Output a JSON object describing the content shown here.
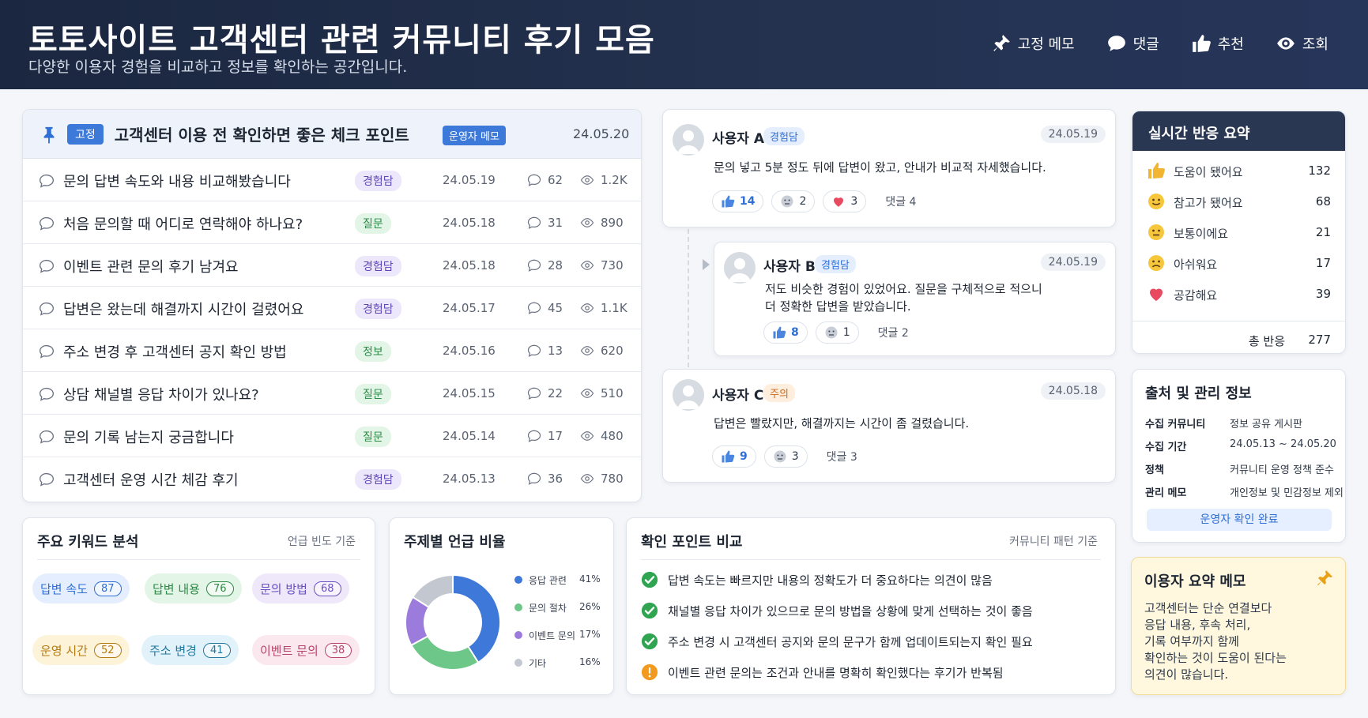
{
  "header": {
    "title": "토토사이트 고객센터 관련 커뮤니티 후기 모음",
    "subtitle": "다양한 이용자 경험을 비교하고 정보를 확인하는 공간입니다.",
    "nav": [
      {
        "label": "고정 메모",
        "icon": "pin-icon"
      },
      {
        "label": "댓글",
        "icon": "comment-icon"
      },
      {
        "label": "추천",
        "icon": "thumbs-up-icon"
      },
      {
        "label": "조회",
        "icon": "eye-icon"
      }
    ]
  },
  "posts": {
    "pinned": {
      "tag": "고정",
      "title": "고객센터 이용 전 확인하면 좋은 체크 포인트",
      "badge": "운영자 메모",
      "date": "24.05.20"
    },
    "rows": [
      {
        "title": "문의 답변 속도와 내용 비교해봤습니다",
        "tag": "경험담",
        "date": "24.05.19",
        "comments": "62",
        "views": "1.2K"
      },
      {
        "title": "처음 문의할 때 어디로 연락해야 하나요?",
        "tag": "질문",
        "date": "24.05.18",
        "comments": "31",
        "views": "890"
      },
      {
        "title": "이벤트 관련 문의 후기 남겨요",
        "tag": "경험담",
        "date": "24.05.18",
        "comments": "28",
        "views": "730"
      },
      {
        "title": "답변은 왔는데 해결까지 시간이 걸렸어요",
        "tag": "경험담",
        "date": "24.05.17",
        "comments": "45",
        "views": "1.1K"
      },
      {
        "title": "주소 변경 후 고객센터 공지 확인 방법",
        "tag": "정보",
        "date": "24.05.16",
        "comments": "13",
        "views": "620"
      },
      {
        "title": "상담 채널별 응답 차이가 있나요?",
        "tag": "질문",
        "date": "24.05.15",
        "comments": "22",
        "views": "510"
      },
      {
        "title": "문의 기록 남는지 궁금합니다",
        "tag": "질문",
        "date": "24.05.14",
        "comments": "17",
        "views": "480"
      },
      {
        "title": "고객센터 운영 시간 체감 후기",
        "tag": "경험담",
        "date": "24.05.13",
        "comments": "36",
        "views": "780"
      }
    ]
  },
  "comments": [
    {
      "user": "사용자 A",
      "tag": "경험담",
      "date": "24.05.19",
      "text": "문의 넣고 5분 정도 뒤에 답변이 왔고, 안내가 비교적 자세했습니다.",
      "likes": "14",
      "neutral": "2",
      "hearts": "3",
      "replies": "댓글 4"
    },
    {
      "user": "사용자 B",
      "tag": "경험담",
      "date": "24.05.19",
      "text1": "저도 비슷한 경험이 있었어요. 질문을 구체적으로 적으니",
      "text2": "더 정확한 답변을 받았습니다.",
      "likes": "8",
      "neutral": "1",
      "replies": "댓글 2"
    },
    {
      "user": "사용자 C",
      "tag": "주의",
      "date": "24.05.18",
      "text": "답변은 빨랐지만, 해결까지는 시간이 좀 걸렸습니다.",
      "likes": "9",
      "neutral": "3",
      "replies": "댓글 3"
    }
  ],
  "summary": {
    "title": "실시간 반응 요약",
    "rows": [
      {
        "label": "도움이 됐어요",
        "value": "132",
        "icon": "thumbs-up-icon"
      },
      {
        "label": "참고가 됐어요",
        "value": "68",
        "icon": "smile-icon"
      },
      {
        "label": "보통이에요",
        "value": "21",
        "icon": "neutral-face-icon"
      },
      {
        "label": "아쉬워요",
        "value": "17",
        "icon": "sad-face-icon"
      },
      {
        "label": "공감해요",
        "value": "39",
        "icon": "heart-icon"
      }
    ],
    "total_label": "총 반응",
    "total_value": "277"
  },
  "source": {
    "title": "출처 및 관리 정보",
    "rows": [
      {
        "key": "수집 커뮤니티",
        "value": "정보 공유 게시판"
      },
      {
        "key": "수집 기간",
        "value": "24.05.13 ~ 24.05.20"
      },
      {
        "key": "정책",
        "value": "커뮤니티 운영 정책 준수"
      },
      {
        "key": "관리 메모",
        "value": "개인정보 및 민감정보 제외"
      }
    ],
    "button": "운영자 확인 완료"
  },
  "memo": {
    "title": "이용자 요약 메모",
    "text": "고객센터는 단순 연결보다\n응답 내용, 후속 처리,\n기록 여부까지 함께\n확인하는 것이 도움이 된다는\n의견이 많습니다."
  },
  "keywords": {
    "title": "주요 키워드 분석",
    "subtitle": "언급 빈도 기준",
    "items": [
      {
        "label": "답변 속도",
        "count": "87",
        "color": "blue"
      },
      {
        "label": "답변 내용",
        "count": "76",
        "color": "green"
      },
      {
        "label": "문의 방법",
        "count": "68",
        "color": "purple"
      },
      {
        "label": "운영 시간",
        "count": "52",
        "color": "yellow"
      },
      {
        "label": "주소 변경",
        "count": "41",
        "color": "cyan"
      },
      {
        "label": "이벤트 문의",
        "count": "38",
        "color": "pink"
      }
    ]
  },
  "ratio": {
    "title": "주제별 언급 비율"
  },
  "chart_data": {
    "type": "pie",
    "categories": [
      "응답 관련",
      "문의 절차",
      "이벤트 문의",
      "기타"
    ],
    "values": [
      41,
      26,
      17,
      16
    ],
    "labels": [
      "41%",
      "26%",
      "17%",
      "16%"
    ],
    "colors": [
      "#3e78d8",
      "#6cc788",
      "#9b7bdc",
      "#c2c7d0"
    ],
    "donut": true
  },
  "compare": {
    "title": "확인 포인트 비교",
    "subtitle": "커뮤니티 패턴 기준",
    "items": [
      {
        "text": "답변 속도는 빠르지만 내용의 정확도가 더 중요하다는 의견이 많음",
        "status": "check"
      },
      {
        "text": "채널별 응답 차이가 있으므로 문의 방법을 상황에 맞게 선택하는 것이 좋음",
        "status": "check"
      },
      {
        "text": "주소 변경 시 고객센터 공지와 문의 문구가 함께 업데이트되는지 확인 필요",
        "status": "check"
      },
      {
        "text": "이벤트 관련 문의는 조건과 안내를 명확히 확인했다는 후기가 반복됨",
        "status": "warning"
      }
    ]
  }
}
